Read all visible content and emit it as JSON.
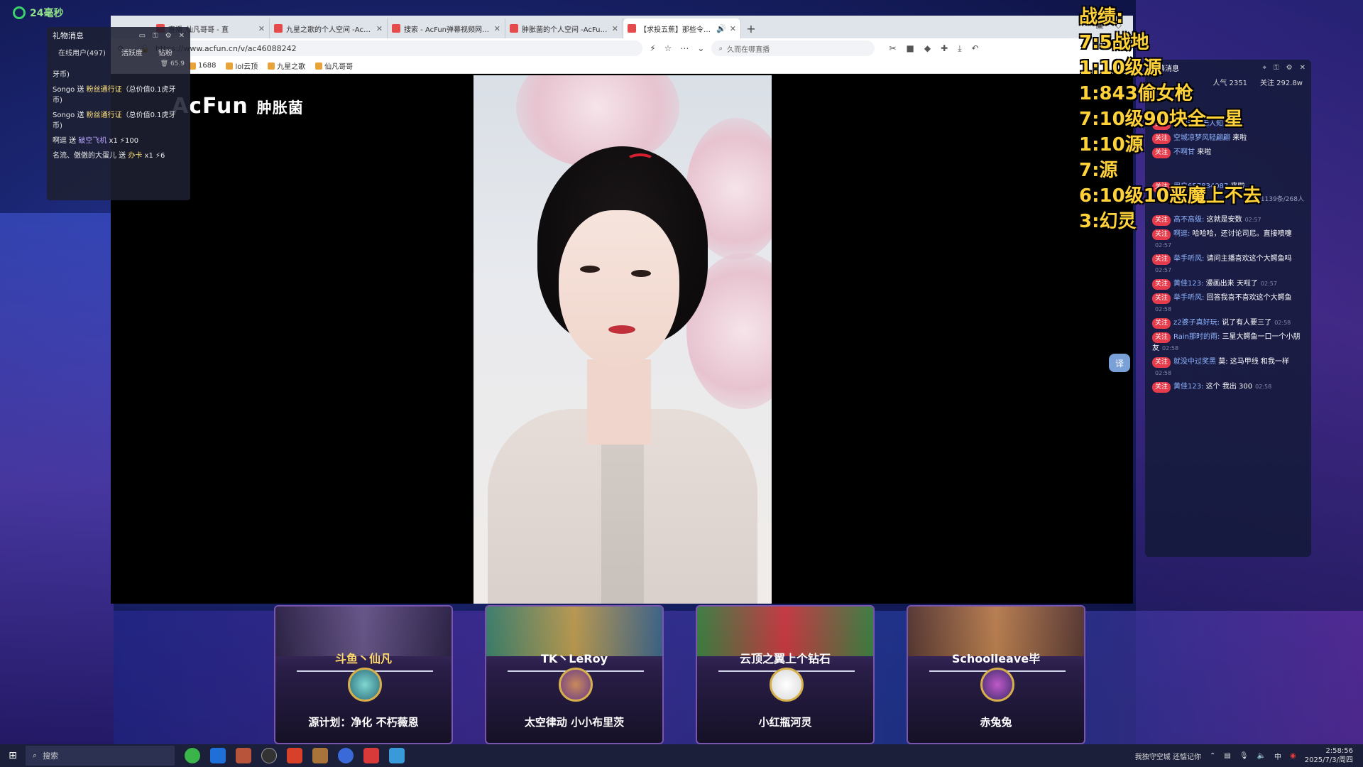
{
  "desktop": {
    "timer": "24毫秒"
  },
  "browser": {
    "tabs": [
      {
        "title": "直播_仙凡哥哥 - 直"
      },
      {
        "title": "九星之歌的个人空间 -AcFun弹"
      },
      {
        "title": "搜索 - AcFun弹幕视频网 - 认"
      },
      {
        "title": "肿胀菌的个人空间 -AcFun弹幕"
      },
      {
        "title": "【求投五蕉】那些令人心动",
        "active": true
      }
    ],
    "url": "https://www.acfun.cn/v/ac46088242",
    "search_placeholder": "久而在哪直播",
    "bookmarks": [
      "1688",
      "lol云顶",
      "九星之歌",
      "仙凡哥哥"
    ]
  },
  "video": {
    "logo_text": "AcFun",
    "logo_cn": "肿胀菌"
  },
  "gift_panel": {
    "title": "礼物消息",
    "online": "在线用户(497)",
    "tab_active": "活跃度",
    "tab_diamond": "钻粉",
    "score": "65.9",
    "lines": [
      {
        "pre": "牙币)"
      },
      {
        "pre": "Songo 送 ",
        "hl": "粉丝通行证",
        "post": "（总价值0.1虎牙币)"
      },
      {
        "pre": "Songo 送 ",
        "hl": "粉丝通行证",
        "post": "（总价值0.1虎牙币)"
      },
      {
        "pre": "啊逗 送 ",
        "purple": "破空飞机",
        "post": " x1  ⚡100"
      },
      {
        "pre": "名流、傲傲的大蛋儿 送 ",
        "hl": "办卡",
        "post": " x1  ⚡6"
      }
    ]
  },
  "chat": {
    "title": "弹幕消息",
    "popularity": "人气 2351",
    "followers": "关注 292.8w",
    "follow_tag": "关注",
    "messages": [
      {
        "user": "夜观天象无人知",
        "text": "来啦"
      },
      {
        "user": "空城凉梦风轻翩翩",
        "text": "来啦"
      },
      {
        "user": "不啊甘",
        "text": "来啦"
      },
      {
        "user": "用户657834087",
        "text": "来啦"
      },
      {
        "user": "高不高级:",
        "text": "这就是安数",
        "time": "02:57"
      },
      {
        "user": "啊逗:",
        "text": "哈哈哈，还讨论司尼。直接喷嚏",
        "time": "02:57"
      },
      {
        "user": "举手听风:",
        "text": "请问主播喜欢这个大鳄鱼吗",
        "time": "02:57"
      },
      {
        "user": "黄佳123:",
        "text": "漫画出来 天啦了",
        "time": "02:57"
      },
      {
        "user": "举手听风:",
        "text": "回答我喜不喜欢这个大鳄鱼",
        "time": "02:58"
      },
      {
        "user": "z2婆子真好玩:",
        "text": "说了有人要三了",
        "time": "02:58"
      },
      {
        "user": "Rain那时的雨:",
        "text": "三星大鳄鱼一口一个小朋友",
        "time": "02:58"
      },
      {
        "user": "就没中过奖黑",
        "text": "莫: 这马甲线 和我一样",
        "time": "02:58"
      },
      {
        "user": "黄佳123:",
        "text": "这个 我出 300",
        "time": "02:58"
      }
    ],
    "count": "1139条/268人"
  },
  "stats": {
    "lines": [
      "战绩:",
      "7:5战地",
      "1:10级源",
      "1:843偷女枪",
      "7:10级90块全一星",
      "1:10源",
      "7:源",
      "6:10级10恶魔上不去",
      "3:幻灵"
    ]
  },
  "cards": [
    {
      "player": "斗鱼丶仙凡",
      "deck": "源计划：净化 不朽薇恩"
    },
    {
      "player": "TK丶LeRoy",
      "deck": "太空律动 小小布里茨"
    },
    {
      "player": "云顶之翼上个钻石",
      "deck": "小红瓶河灵"
    },
    {
      "player": "Schoolleave毕",
      "deck": "赤兔兔"
    }
  ],
  "taskbar": {
    "search": "搜索",
    "tray_text": "我独守空城 还惦记你",
    "ime": "中",
    "time": "2:58:56",
    "date": "2025/7/3/周四"
  }
}
